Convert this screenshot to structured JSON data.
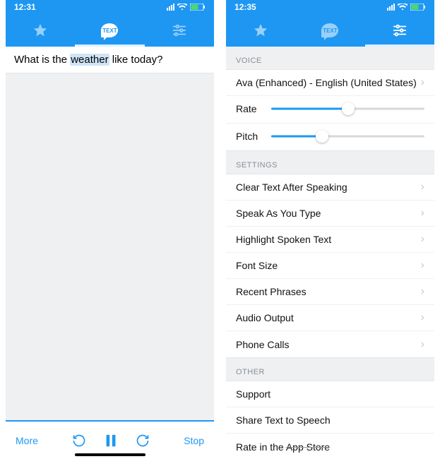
{
  "left": {
    "time": "12:31",
    "sentence_pre": "What is the ",
    "sentence_hl": "weather",
    "sentence_post": " like today?",
    "more": "More",
    "stop": "Stop"
  },
  "right": {
    "time": "12:35",
    "sections": {
      "voice_header": "VOICE",
      "voice_name": "Ava (Enhanced) - English (United States)",
      "rate_label": "Rate",
      "rate_value": 0.5,
      "pitch_label": "Pitch",
      "pitch_value": 0.33,
      "settings_header": "SETTINGS",
      "settings_items": [
        "Clear Text After Speaking",
        "Speak As You Type",
        "Highlight Spoken Text",
        "Font Size",
        "Recent Phrases",
        "Audio Output",
        "Phone Calls"
      ],
      "other_header": "OTHER",
      "other_items": [
        "Support",
        "Share Text to Speech"
      ],
      "other_partial_pre": "Rate in the ",
      "other_partial_strike": "App Store"
    }
  },
  "tabs": {
    "text_badge": "TEXT"
  }
}
